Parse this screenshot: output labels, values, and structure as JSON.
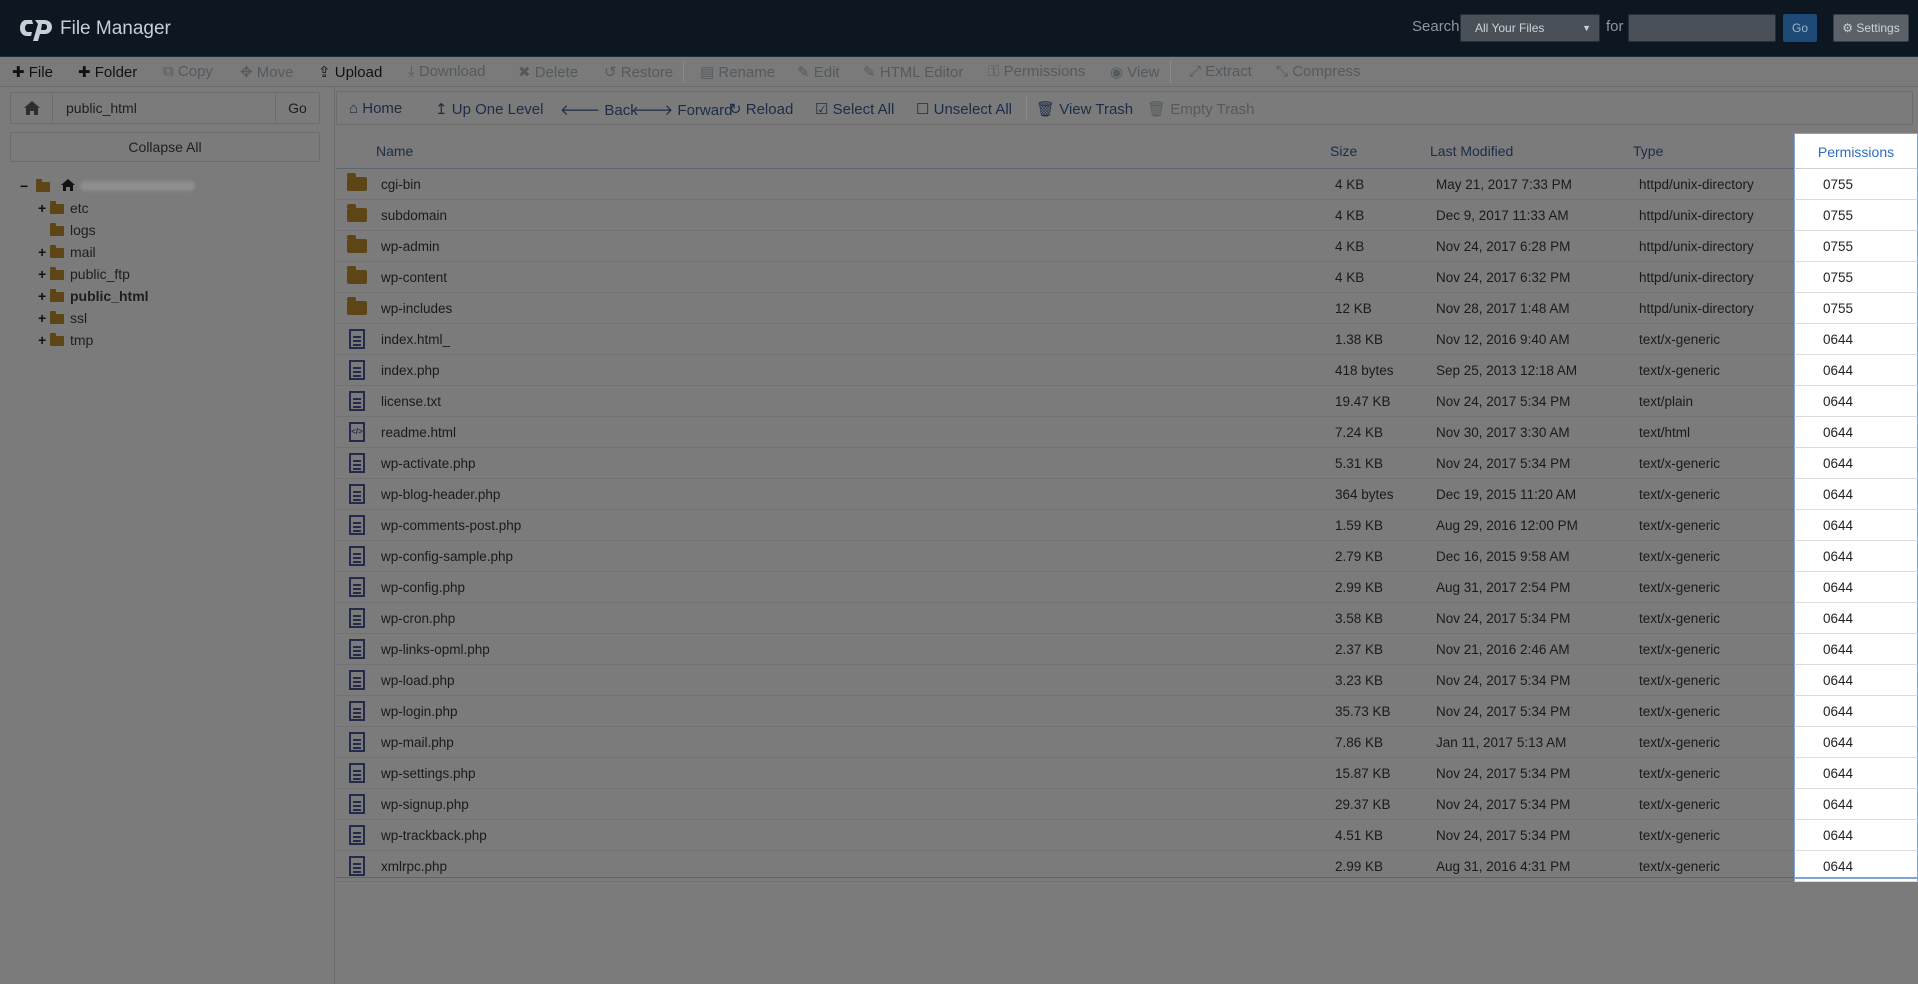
{
  "header": {
    "app_title": "File Manager",
    "search_label": "Search",
    "search_scope": "All Your Files",
    "for_label": "for",
    "search_value": "",
    "go_label": "Go",
    "settings_label": "Settings"
  },
  "toolbar": {
    "file": "File",
    "folder": "Folder",
    "copy": "Copy",
    "move": "Move",
    "upload": "Upload",
    "download": "Download",
    "delete": "Delete",
    "restore": "Restore",
    "rename": "Rename",
    "edit": "Edit",
    "html_editor": "HTML Editor",
    "permissions": "Permissions",
    "view": "View",
    "extract": "Extract",
    "compress": "Compress"
  },
  "left": {
    "path_value": "public_html",
    "go_label": "Go",
    "collapse_label": "Collapse All",
    "tree": [
      "etc",
      "logs",
      "mail",
      "public_ftp",
      "public_html",
      "ssl",
      "tmp"
    ]
  },
  "nav": {
    "home": "Home",
    "up": "Up One Level",
    "back": "Back",
    "forward": "Forward",
    "reload": "Reload",
    "select_all": "Select All",
    "unselect_all": "Unselect All",
    "view_trash": "View Trash",
    "empty_trash": "Empty Trash"
  },
  "table": {
    "headers": {
      "name": "Name",
      "size": "Size",
      "modified": "Last Modified",
      "type": "Type",
      "permissions": "Permissions"
    },
    "rows": [
      {
        "name": "cgi-bin",
        "size": "4 KB",
        "modified": "May 21, 2017 7:33 PM",
        "type": "httpd/unix-directory",
        "perm": "0755",
        "icon": "folder-icon"
      },
      {
        "name": "subdomain",
        "size": "4 KB",
        "modified": "Dec 9, 2017 11:33 AM",
        "type": "httpd/unix-directory",
        "perm": "0755",
        "icon": "folder-icon"
      },
      {
        "name": "wp-admin",
        "size": "4 KB",
        "modified": "Nov 24, 2017 6:28 PM",
        "type": "httpd/unix-directory",
        "perm": "0755",
        "icon": "folder-icon"
      },
      {
        "name": "wp-content",
        "size": "4 KB",
        "modified": "Nov 24, 2017 6:32 PM",
        "type": "httpd/unix-directory",
        "perm": "0755",
        "icon": "folder-icon"
      },
      {
        "name": "wp-includes",
        "size": "12 KB",
        "modified": "Nov 28, 2017 1:48 AM",
        "type": "httpd/unix-directory",
        "perm": "0755",
        "icon": "folder-icon"
      },
      {
        "name": "index.html_",
        "size": "1.38 KB",
        "modified": "Nov 12, 2016 9:40 AM",
        "type": "text/x-generic",
        "perm": "0644",
        "icon": "file-icon"
      },
      {
        "name": "index.php",
        "size": "418 bytes",
        "modified": "Sep 25, 2013 12:18 AM",
        "type": "text/x-generic",
        "perm": "0644",
        "icon": "file-icon"
      },
      {
        "name": "license.txt",
        "size": "19.47 KB",
        "modified": "Nov 24, 2017 5:34 PM",
        "type": "text/plain",
        "perm": "0644",
        "icon": "file-icon"
      },
      {
        "name": "readme.html",
        "size": "7.24 KB",
        "modified": "Nov 30, 2017 3:30 AM",
        "type": "text/html",
        "perm": "0644",
        "icon": "code-file-icon"
      },
      {
        "name": "wp-activate.php",
        "size": "5.31 KB",
        "modified": "Nov 24, 2017 5:34 PM",
        "type": "text/x-generic",
        "perm": "0644",
        "icon": "file-icon"
      },
      {
        "name": "wp-blog-header.php",
        "size": "364 bytes",
        "modified": "Dec 19, 2015 11:20 AM",
        "type": "text/x-generic",
        "perm": "0644",
        "icon": "file-icon"
      },
      {
        "name": "wp-comments-post.php",
        "size": "1.59 KB",
        "modified": "Aug 29, 2016 12:00 PM",
        "type": "text/x-generic",
        "perm": "0644",
        "icon": "file-icon"
      },
      {
        "name": "wp-config-sample.php",
        "size": "2.79 KB",
        "modified": "Dec 16, 2015 9:58 AM",
        "type": "text/x-generic",
        "perm": "0644",
        "icon": "file-icon"
      },
      {
        "name": "wp-config.php",
        "size": "2.99 KB",
        "modified": "Aug 31, 2017 2:54 PM",
        "type": "text/x-generic",
        "perm": "0644",
        "icon": "file-icon"
      },
      {
        "name": "wp-cron.php",
        "size": "3.58 KB",
        "modified": "Nov 24, 2017 5:34 PM",
        "type": "text/x-generic",
        "perm": "0644",
        "icon": "file-icon"
      },
      {
        "name": "wp-links-opml.php",
        "size": "2.37 KB",
        "modified": "Nov 21, 2016 2:46 AM",
        "type": "text/x-generic",
        "perm": "0644",
        "icon": "file-icon"
      },
      {
        "name": "wp-load.php",
        "size": "3.23 KB",
        "modified": "Nov 24, 2017 5:34 PM",
        "type": "text/x-generic",
        "perm": "0644",
        "icon": "file-icon"
      },
      {
        "name": "wp-login.php",
        "size": "35.73 KB",
        "modified": "Nov 24, 2017 5:34 PM",
        "type": "text/x-generic",
        "perm": "0644",
        "icon": "file-icon"
      },
      {
        "name": "wp-mail.php",
        "size": "7.86 KB",
        "modified": "Jan 11, 2017 5:13 AM",
        "type": "text/x-generic",
        "perm": "0644",
        "icon": "file-icon"
      },
      {
        "name": "wp-settings.php",
        "size": "15.87 KB",
        "modified": "Nov 24, 2017 5:34 PM",
        "type": "text/x-generic",
        "perm": "0644",
        "icon": "file-icon"
      },
      {
        "name": "wp-signup.php",
        "size": "29.37 KB",
        "modified": "Nov 24, 2017 5:34 PM",
        "type": "text/x-generic",
        "perm": "0644",
        "icon": "file-icon"
      },
      {
        "name": "wp-trackback.php",
        "size": "4.51 KB",
        "modified": "Nov 24, 2017 5:34 PM",
        "type": "text/x-generic",
        "perm": "0644",
        "icon": "file-icon"
      },
      {
        "name": "xmlrpc.php",
        "size": "2.99 KB",
        "modified": "Aug 31, 2016 4:31 PM",
        "type": "text/x-generic",
        "perm": "0644",
        "icon": "file-icon"
      }
    ]
  }
}
